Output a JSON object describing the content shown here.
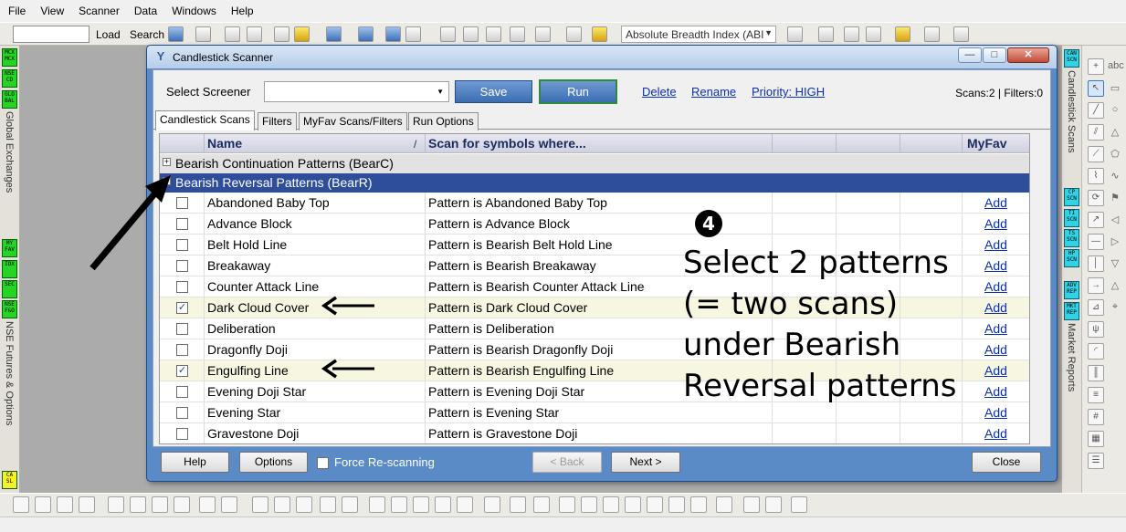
{
  "menu": [
    "File",
    "View",
    "Scanner",
    "Data",
    "Windows",
    "Help"
  ],
  "toolbar": {
    "load_label": "Load",
    "search_label": "Search",
    "index_combo_value": "Absolute Breadth Index (ABI"
  },
  "left_panel": {
    "buttons_top": [
      "MCX MCX",
      "NSE CD",
      "GLO BAL"
    ],
    "label_top": "Global Exchanges",
    "buttons_mid": [
      "MY FAV",
      "IDX",
      "SEC",
      "NSE F&O"
    ],
    "label_mid": "NSE Futures & Options",
    "button_bottom": "CA SL"
  },
  "right_panel": {
    "buttons_top": [
      "CAN SCN"
    ],
    "label_top": "Candlestick Scans",
    "buttons_mid": [
      "CP SCN",
      "TI SCN",
      "TS SCN",
      "HP SCN"
    ],
    "buttons_low": [
      "ADV REP",
      "MKT REP"
    ],
    "label_low": "Market Reports"
  },
  "dialog": {
    "title": "Candlestick Scanner",
    "select_screener_label": "Select Screener",
    "screener_value": "",
    "save_label": "Save",
    "run_label": "Run",
    "delete_label": "Delete",
    "rename_label": "Rename",
    "priority_label": "Priority: HIGH",
    "scans_info": "Scans:2 | Filters:0",
    "tabs": [
      "Candlestick Scans",
      "Filters",
      "MyFav Scans/Filters",
      "Run Options"
    ],
    "active_tab": "Candlestick Scans",
    "columns": {
      "name": "Name",
      "sort_marker": "/",
      "scan": "Scan for symbols where...",
      "myfav": "MyFav"
    },
    "groups": [
      {
        "label": "Bearish Continuation Patterns (BearC)",
        "expanded": false
      },
      {
        "label": "Bearish Reversal Patterns (BearR)",
        "expanded": true
      }
    ],
    "rows": [
      {
        "name": "Abandoned Baby Top",
        "scan": "Pattern is Abandoned Baby Top",
        "checked": false,
        "fav": "Add"
      },
      {
        "name": "Advance Block",
        "scan": "Pattern is Advance Block",
        "checked": false,
        "fav": "Add"
      },
      {
        "name": "Belt Hold Line",
        "scan": "Pattern is Bearish Belt Hold Line",
        "checked": false,
        "fav": "Add"
      },
      {
        "name": "Breakaway",
        "scan": "Pattern is Bearish Breakaway",
        "checked": false,
        "fav": "Add"
      },
      {
        "name": "Counter Attack Line",
        "scan": "Pattern is Bearish Counter Attack Line",
        "checked": false,
        "fav": "Add"
      },
      {
        "name": "Dark Cloud Cover",
        "scan": "Pattern is Dark Cloud Cover",
        "checked": true,
        "fav": "Add"
      },
      {
        "name": "Deliberation",
        "scan": "Pattern is Deliberation",
        "checked": false,
        "fav": "Add"
      },
      {
        "name": "Dragonfly Doji",
        "scan": "Pattern is Bearish Dragonfly Doji",
        "checked": false,
        "fav": "Add"
      },
      {
        "name": "Engulfing Line",
        "scan": "Pattern is Bearish Engulfing Line",
        "checked": true,
        "fav": "Add"
      },
      {
        "name": "Evening Doji Star",
        "scan": "Pattern is Evening Doji Star",
        "checked": false,
        "fav": "Add"
      },
      {
        "name": "Evening Star",
        "scan": "Pattern is Evening Star",
        "checked": false,
        "fav": "Add"
      },
      {
        "name": "Gravestone Doji",
        "scan": "Pattern is Gravestone Doji",
        "checked": false,
        "fav": "Add"
      }
    ],
    "footer": {
      "help_label": "Help",
      "options_label": "Options",
      "force_label": "Force Re-scanning",
      "force_checked": false,
      "back_label": "< Back",
      "next_label": "Next >",
      "close_label": "Close"
    }
  },
  "annotation": {
    "number": "4",
    "lines": [
      "Select 2 patterns",
      "(= two scans)",
      "under Bearish",
      "Reversal patterns"
    ]
  },
  "colors": {
    "dialog_frame": "#5a8bc6",
    "group_selected": "#2e4e9c",
    "button_blue": "#3b6db3",
    "link": "#0b2fb3",
    "panel_green": "#26d426",
    "panel_cyan": "#2ed4e6"
  }
}
